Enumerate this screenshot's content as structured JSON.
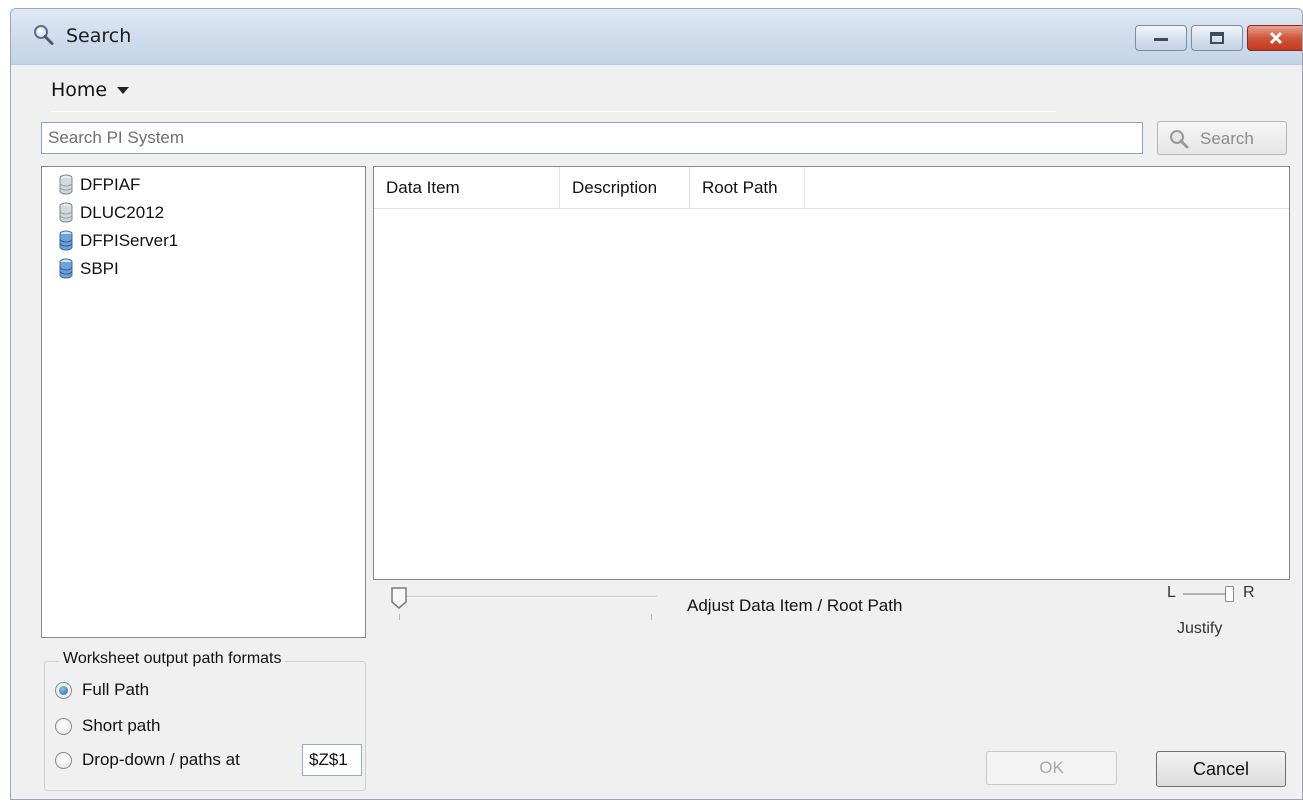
{
  "window": {
    "title": "Search"
  },
  "menu": {
    "home_label": "Home"
  },
  "search": {
    "placeholder": "Search PI System",
    "value": "",
    "button_label": "Search"
  },
  "tree": {
    "items": [
      {
        "label": "DFPIAF",
        "icon": "database-icon"
      },
      {
        "label": "DLUC2012",
        "icon": "database-icon"
      },
      {
        "label": "DFPIServer1",
        "icon": "server-icon"
      },
      {
        "label": "SBPI",
        "icon": "server-icon"
      }
    ]
  },
  "grid": {
    "columns": [
      "Data Item",
      "Description",
      "Root Path"
    ],
    "rows": []
  },
  "slider": {
    "label": "Adjust Data Item / Root Path",
    "value": 0
  },
  "justify": {
    "left": "L",
    "right": "R",
    "label": "Justify",
    "selected": "R"
  },
  "output_formats": {
    "legend": "Worksheet output path formats",
    "options": [
      "Full Path",
      "Short path",
      "Drop-down / paths at"
    ],
    "selected": "Full Path",
    "cell_ref": "$Z$1"
  },
  "buttons": {
    "ok": "OK",
    "cancel": "Cancel"
  },
  "colors": {
    "accent": "#1b5fa8",
    "close": "#c23a1f"
  }
}
